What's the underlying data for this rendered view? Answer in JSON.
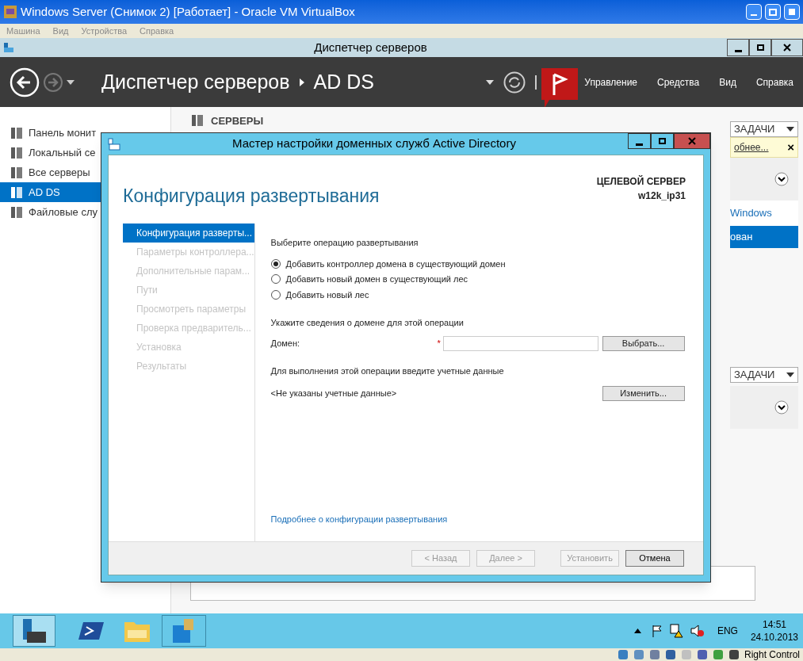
{
  "host_window": {
    "title": "Windows Server (Снимок 2) [Работает] - Oracle VM VirtualBox",
    "menu": [
      "Машина",
      "Вид",
      "Устройства",
      "Справка"
    ]
  },
  "app_window": {
    "title": "Диспетчер серверов"
  },
  "header": {
    "breadcrumb": [
      "Диспетчер серверов",
      "AD DS"
    ],
    "menu": [
      "Управление",
      "Средства",
      "Вид",
      "Справка"
    ]
  },
  "sidebar": {
    "items": [
      {
        "label": "Панель монит",
        "selected": false
      },
      {
        "label": "Локальный се",
        "selected": false
      },
      {
        "label": "Все серверы",
        "selected": false
      },
      {
        "label": "AD DS",
        "selected": true
      },
      {
        "label": "Файловые слу",
        "selected": false
      }
    ]
  },
  "content": {
    "section_title": "СЕРВЕРЫ",
    "tasks_button": "ЗАДАЧИ",
    "notice_link": "обнее...",
    "notice_close": "×",
    "tab_fragment": "Windows",
    "row_fragment": "ован",
    "tasks_button_2": "ЗАДАЧИ"
  },
  "dialog": {
    "title": "Мастер настройки доменных служб Active Directory",
    "heading": "Конфигурация развертывания",
    "target_label": "ЦЕЛЕВОЙ СЕРВЕР",
    "target_value": "w12k_ip31",
    "steps": [
      {
        "label": "Конфигурация разверты...",
        "selected": true
      },
      {
        "label": "Параметры контроллера...",
        "selected": false
      },
      {
        "label": "Дополнительные парам...",
        "selected": false
      },
      {
        "label": "Пути",
        "selected": false
      },
      {
        "label": "Просмотреть параметры",
        "selected": false
      },
      {
        "label": "Проверка предваритель...",
        "selected": false
      },
      {
        "label": "Установка",
        "selected": false
      },
      {
        "label": "Результаты",
        "selected": false
      }
    ],
    "operation_label": "Выберите операцию развертывания",
    "operations": [
      {
        "label": "Добавить контроллер домена в существующий домен",
        "selected": true
      },
      {
        "label": "Добавить новый домен в существующий лес",
        "selected": false
      },
      {
        "label": "Добавить новый лес",
        "selected": false
      }
    ],
    "domain_section": "Укажите сведения о домене для этой операции",
    "domain_label": "Домен:",
    "required_mark": "*",
    "select_button": "Выбрать...",
    "credentials_section": "Для выполнения этой операции введите учетные данные",
    "credentials_value": "<Не указаны учетные данные>",
    "change_button": "Изменить...",
    "more_link": "Подробнее о конфигурации развертывания",
    "buttons": [
      {
        "label": "< Назад",
        "disabled": true
      },
      {
        "label": "Далее >",
        "disabled": true
      },
      {
        "label": "Установить",
        "disabled": true
      },
      {
        "label": "Отмена",
        "disabled": false
      }
    ]
  },
  "taskbar": {
    "language": "ENG",
    "time": "14:51",
    "date": "24.10.2013"
  },
  "host_status": {
    "host_key": "Right Control"
  }
}
